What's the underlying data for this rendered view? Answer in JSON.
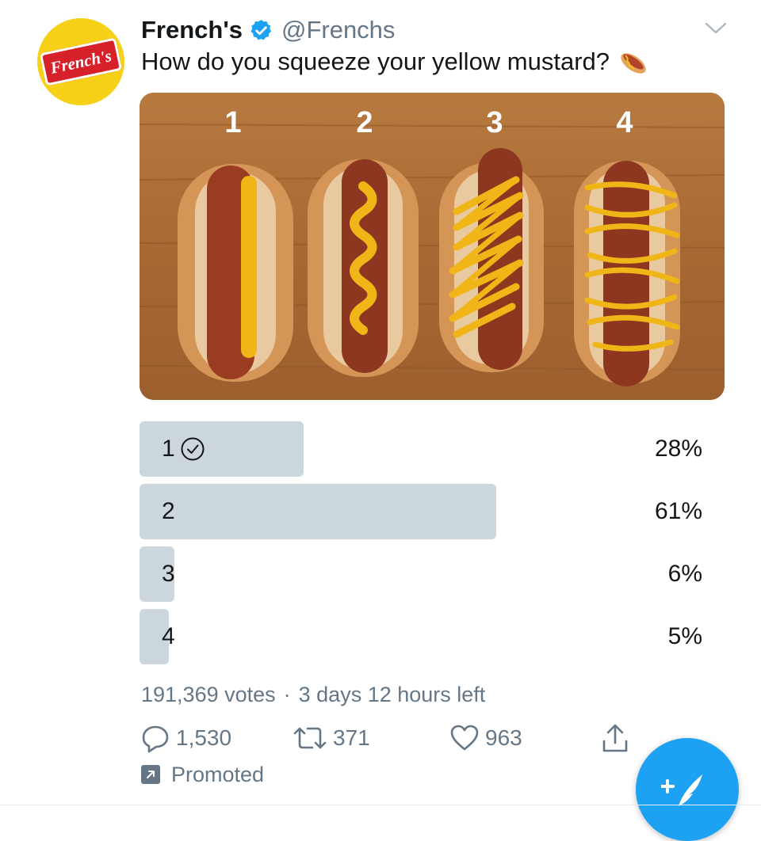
{
  "account": {
    "avatar_text": "French's",
    "name": "French's",
    "handle": "@Frenchs"
  },
  "tweet": {
    "text": "How do you squeeze your yellow mustard?"
  },
  "photo": {
    "numbers": [
      "1",
      "2",
      "3",
      "4"
    ]
  },
  "poll": {
    "options": [
      {
        "label": "1",
        "percent_text": "28%",
        "percent": 28,
        "selected": true
      },
      {
        "label": "2",
        "percent_text": "61%",
        "percent": 61,
        "selected": false
      },
      {
        "label": "3",
        "percent_text": "6%",
        "percent": 6,
        "selected": false
      },
      {
        "label": "4",
        "percent_text": "5%",
        "percent": 5,
        "selected": false
      }
    ],
    "votes": "191,369 votes",
    "separator": "·",
    "time_left": "3 days 12 hours left"
  },
  "actions": {
    "replies": "1,530",
    "retweets": "371",
    "likes": "963"
  },
  "promoted_label": "Promoted",
  "colors": {
    "poll_bar": "#ccd6dd",
    "accent": "#1da1f2",
    "secondary_text": "#657786",
    "avatar_bg": "#f7d117"
  }
}
